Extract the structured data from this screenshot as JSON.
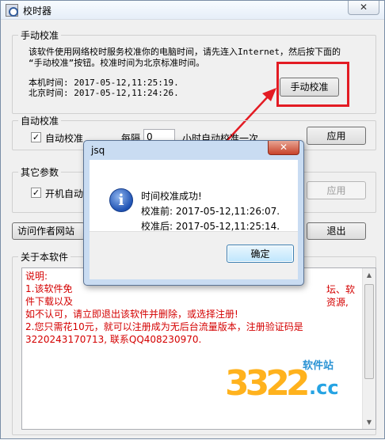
{
  "window": {
    "title": "校时器",
    "close_glyph": "✕"
  },
  "manual": {
    "group_label": "手动校准",
    "description_line1": "该软件使用网络校时服务校准你的电脑时间，请先连入Internet，然后按下面的",
    "description_line2": "“手动校准”按钮。校准时间为北京标准时间。",
    "local_time": "本机时间: 2017-05-12,11:25:19.",
    "beijing_time": "北京时间: 2017-05-12,11:24:26.",
    "button_label": "手动校准"
  },
  "auto": {
    "group_label": "自动校准",
    "checkbox_label": "自动校准",
    "checked": true,
    "every_label": "每隔",
    "interval_value": "0",
    "suffix_label": "小时自动校准一次",
    "apply_label": "应用"
  },
  "other": {
    "group_label": "其它参数",
    "checkbox_label": "开机自动",
    "checked": true,
    "apply_label": "应用"
  },
  "toolbar": {
    "visit_label": "访问作者网站",
    "exit_label": "退出"
  },
  "about": {
    "group_label": "关于本软件",
    "lines": [
      "说明:",
      "1.该软件免",
      "件下载以及",
      "如不认可，请立即退出该软件并删除，或选择注册!",
      "2.您只需花10元，就可以注册成为无后台流量版本，注册验证码是",
      "3220243170713, 联系QQ408230970."
    ],
    "right_fragments": [
      "坛、软",
      "资源,"
    ]
  },
  "dialog": {
    "title": "jsq",
    "close_glyph": "✕",
    "message_title": "时间校准成功!",
    "before": "校准前: 2017-05-12,11:26:07.",
    "after": "校准后: 2017-05-12,11:25:14.",
    "ok_label": "确定"
  },
  "watermark": {
    "digits": "3322",
    "suffix": ".cc",
    "site": "软件站"
  },
  "colors": {
    "highlight": "#e31b23",
    "about_text": "#d40000"
  }
}
